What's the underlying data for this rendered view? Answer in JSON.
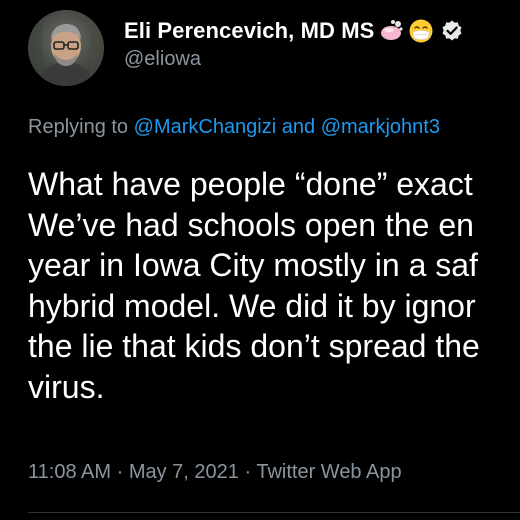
{
  "author": {
    "display_name": "Eli Perencevich, MD MS",
    "handle": "@eliowa",
    "badges": [
      "soap-icon",
      "mask-face-icon",
      "verified-badge-icon"
    ]
  },
  "reply": {
    "prefix": "Replying to",
    "mention_1": "@MarkChangizi",
    "conjunction": "and",
    "mention_2": "@markjohnt3"
  },
  "tweet": {
    "lines": [
      "What have people “done” exact",
      "We’ve had schools open the en",
      "year in Iowa City mostly in a saf",
      "hybrid model. We did it by ignor",
      "the lie that kids don’t spread the",
      "virus."
    ]
  },
  "meta": {
    "time": "11:08 AM",
    "date": "May 7, 2021",
    "source": "Twitter Web App",
    "separator": "·"
  },
  "colors": {
    "background": "#000000",
    "text": "#ffffff",
    "secondary": "#8b959e",
    "link": "#1d9bf0"
  }
}
